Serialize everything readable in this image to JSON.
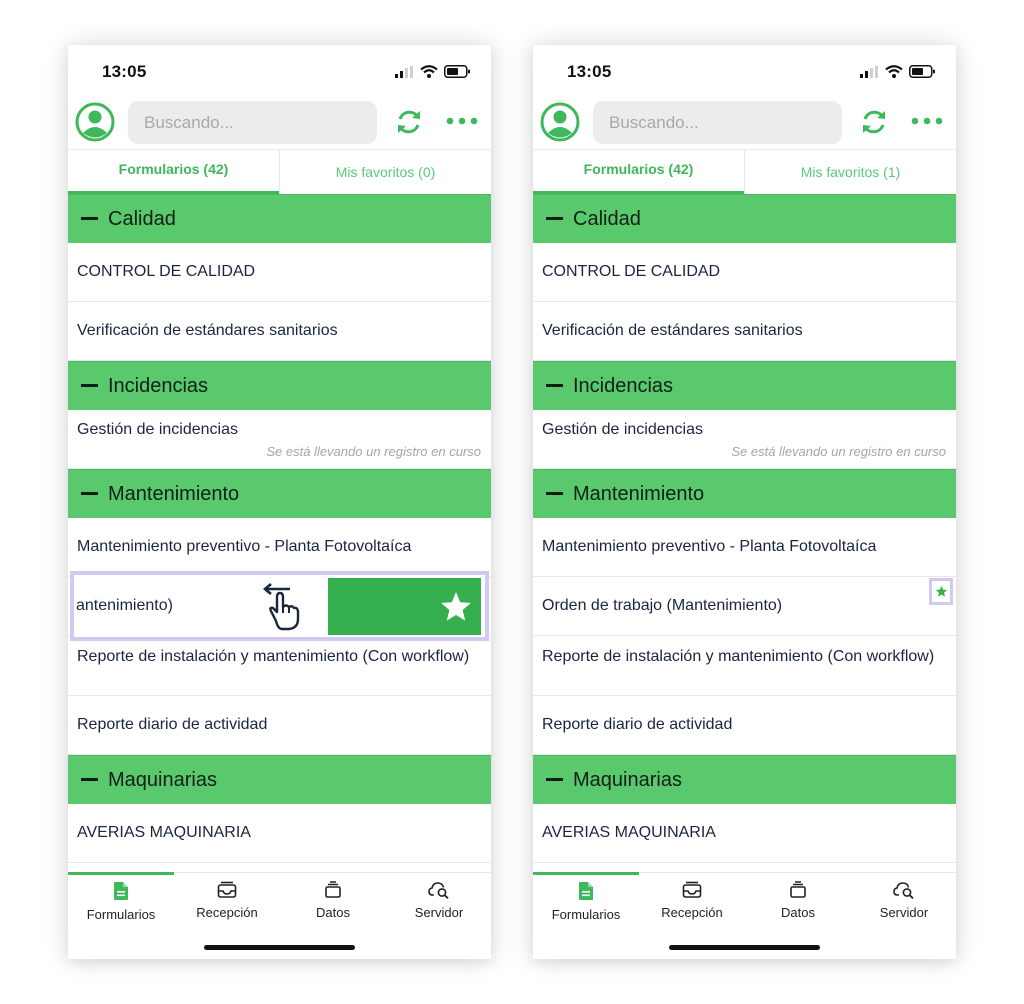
{
  "colors": {
    "accent": "#3db85a",
    "section_bg": "#5ac86d",
    "swipe_action": "#36b04f",
    "highlight": "#d2c9f2"
  },
  "screens": [
    {
      "status": {
        "time": "13:05"
      },
      "search": {
        "placeholder": "Buscando..."
      },
      "tabs": [
        {
          "label": "Formularios (42)"
        },
        {
          "label": "Mis favoritos (0)"
        }
      ],
      "sections": [
        {
          "title": "Calidad",
          "items": [
            {
              "label": "CONTROL DE CALIDAD"
            },
            {
              "label": "Verificación de estándares sanitarios"
            }
          ]
        },
        {
          "title": "Incidencias",
          "items": [
            {
              "label": "Gestión de incidencias",
              "note": "Se está llevando un registro en curso"
            }
          ]
        },
        {
          "title": "Mantenimiento",
          "items": [
            {
              "label": "Mantenimiento preventivo - Planta Fotovoltaíca"
            },
            {
              "label": "Orden de trabajo (Mantenimiento)",
              "visible_label": "antenimiento)"
            },
            {
              "label": "Reporte de instalación y mantenimiento (Con workflow)"
            },
            {
              "label": "Reporte diario de actividad"
            }
          ]
        },
        {
          "title": "Maquinarias",
          "items": [
            {
              "label": "AVERIAS MAQUINARIA"
            }
          ]
        }
      ],
      "nav": [
        {
          "label": "Formularios",
          "icon": "document-icon"
        },
        {
          "label": "Recepción",
          "icon": "inbox-icon"
        },
        {
          "label": "Datos",
          "icon": "database-icon"
        },
        {
          "label": "Servidor",
          "icon": "cloud-search-icon"
        }
      ]
    },
    {
      "status": {
        "time": "13:05"
      },
      "search": {
        "placeholder": "Buscando..."
      },
      "tabs": [
        {
          "label": "Formularios (42)"
        },
        {
          "label": "Mis favoritos (1)"
        }
      ],
      "sections": [
        {
          "title": "Calidad",
          "items": [
            {
              "label": "CONTROL DE CALIDAD"
            },
            {
              "label": "Verificación de estándares sanitarios"
            }
          ]
        },
        {
          "title": "Incidencias",
          "items": [
            {
              "label": "Gestión de incidencias",
              "note": "Se está llevando un registro en curso"
            }
          ]
        },
        {
          "title": "Mantenimiento",
          "items": [
            {
              "label": "Mantenimiento preventivo - Planta Fotovoltaíca"
            },
            {
              "label": "Orden de trabajo (Mantenimiento)",
              "favorite": true
            },
            {
              "label": "Reporte de instalación y mantenimiento (Con workflow)"
            },
            {
              "label": "Reporte diario de actividad"
            }
          ]
        },
        {
          "title": "Maquinarias",
          "items": [
            {
              "label": "AVERIAS MAQUINARIA"
            }
          ]
        }
      ],
      "nav": [
        {
          "label": "Formularios",
          "icon": "document-icon"
        },
        {
          "label": "Recepción",
          "icon": "inbox-icon"
        },
        {
          "label": "Datos",
          "icon": "database-icon"
        },
        {
          "label": "Servidor",
          "icon": "cloud-search-icon"
        }
      ]
    }
  ]
}
